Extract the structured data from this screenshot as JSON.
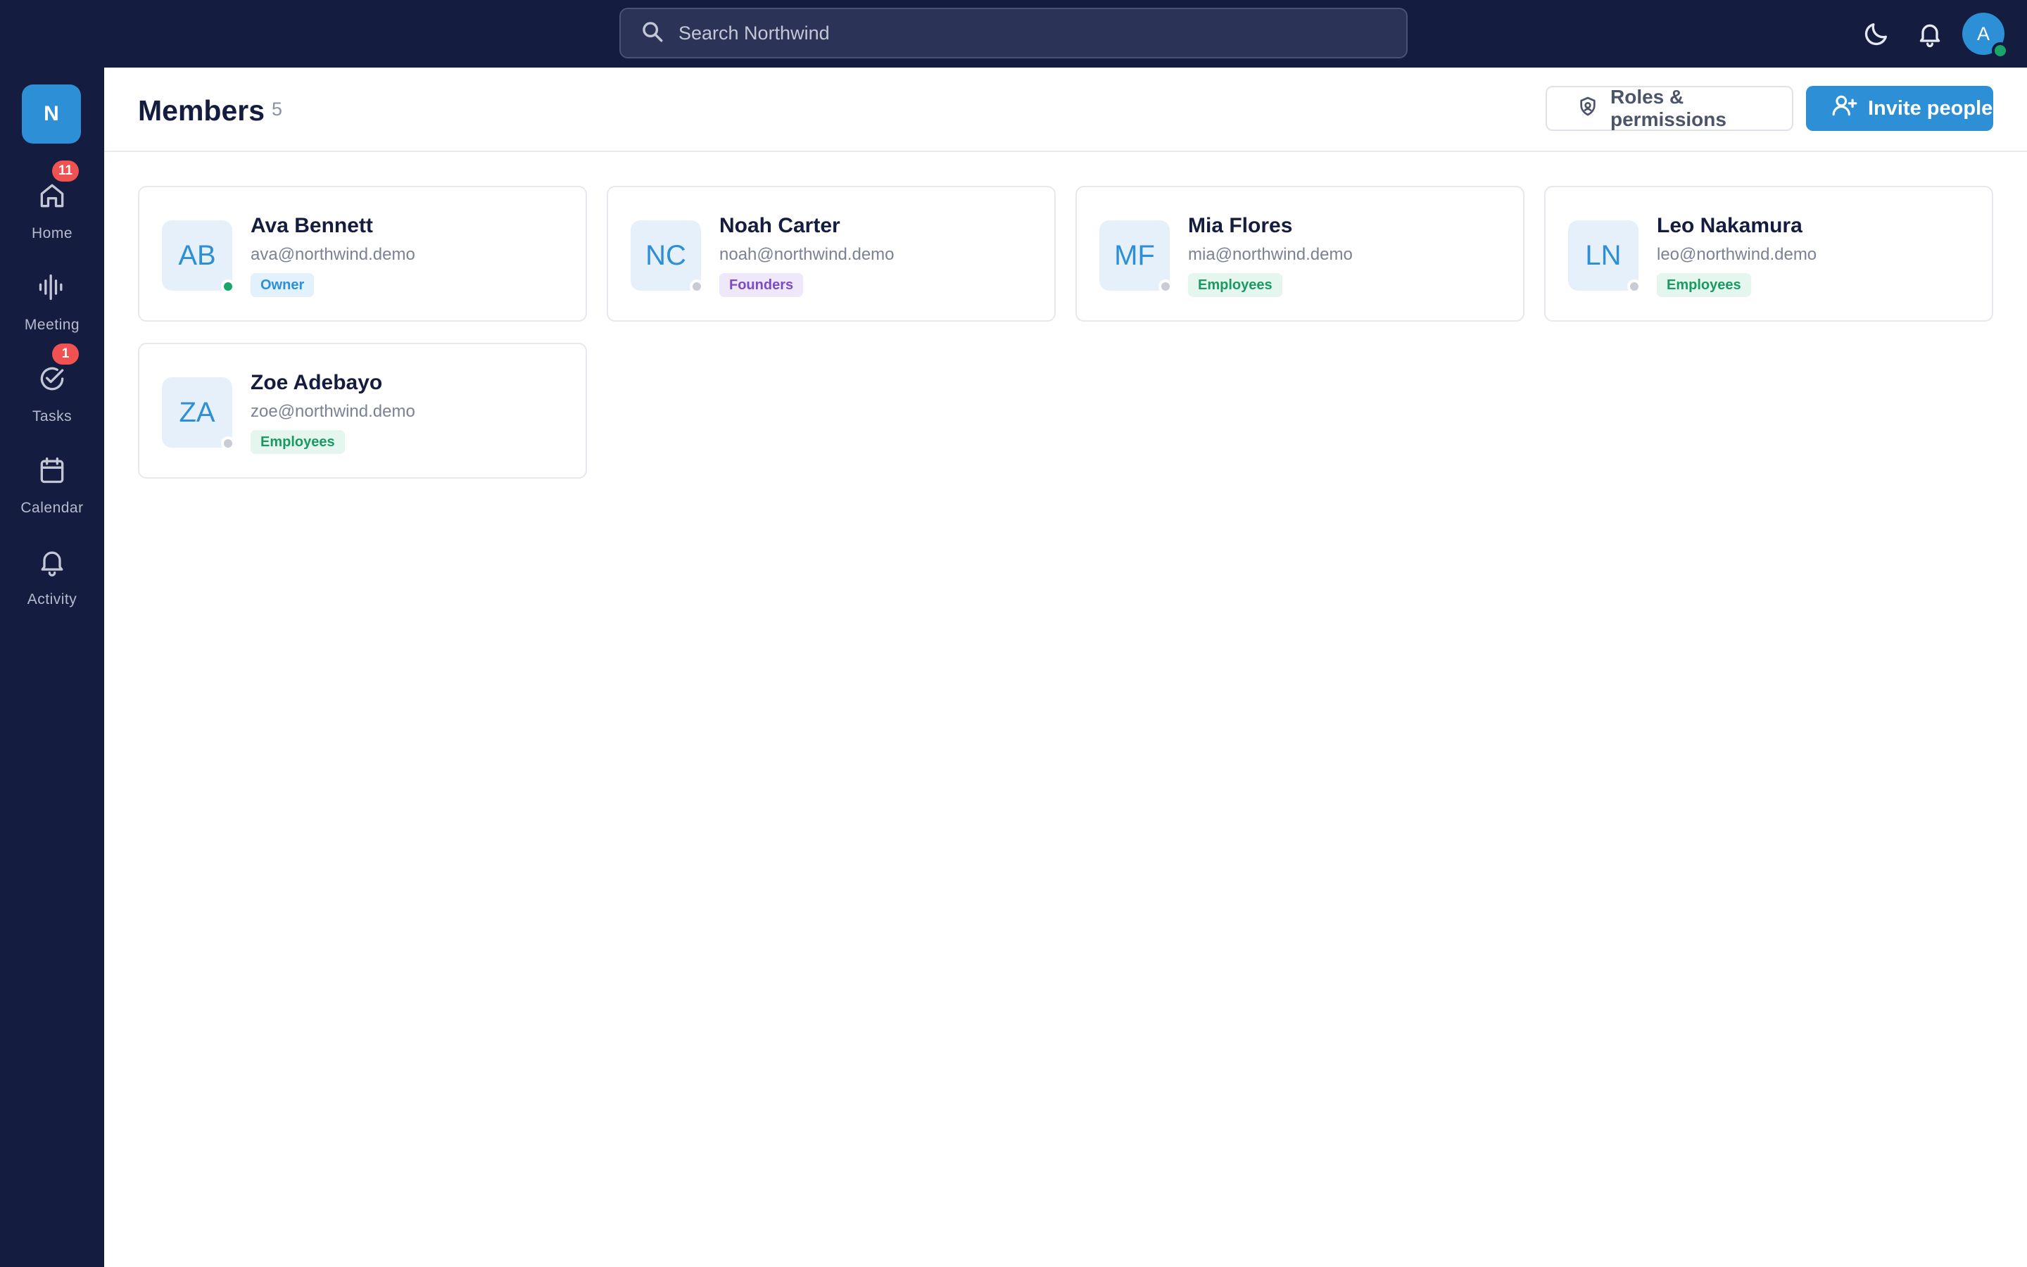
{
  "search": {
    "placeholder": "Search Northwind"
  },
  "topbar": {
    "user_initial": "A"
  },
  "workspace": {
    "initial": "N"
  },
  "sidebar": {
    "items": [
      {
        "label": "Home",
        "icon": "home-icon",
        "badge": "11"
      },
      {
        "label": "Meeting",
        "icon": "waveform-icon",
        "badge": ""
      },
      {
        "label": "Tasks",
        "icon": "check-circle-icon",
        "badge": "1"
      },
      {
        "label": "Calendar",
        "icon": "calendar-icon",
        "badge": ""
      },
      {
        "label": "Activity",
        "icon": "bell-icon",
        "badge": ""
      }
    ]
  },
  "header": {
    "title": "Members",
    "count": "5",
    "roles_label": "Roles & permissions",
    "invite_label": "Invite people"
  },
  "members": [
    {
      "initials": "AB",
      "name": "Ava Bennett",
      "email": "ava@northwind.demo",
      "tag": "Owner",
      "status": "online"
    },
    {
      "initials": "NC",
      "name": "Noah Carter",
      "email": "noah@northwind.demo",
      "tag": "Founders",
      "status": "offline"
    },
    {
      "initials": "MF",
      "name": "Mia Flores",
      "email": "mia@northwind.demo",
      "tag": "Employees",
      "status": "offline"
    },
    {
      "initials": "LN",
      "name": "Leo Nakamura",
      "email": "leo@northwind.demo",
      "tag": "Employees",
      "status": "offline"
    },
    {
      "initials": "ZA",
      "name": "Zoe Adebayo",
      "email": "zoe@northwind.demo",
      "tag": "Employees",
      "status": "offline"
    }
  ],
  "colors": {
    "nav_bg": "#141c3f",
    "accent": "#2d8fd6",
    "badge": "#f05252",
    "online": "#1aa56b"
  }
}
